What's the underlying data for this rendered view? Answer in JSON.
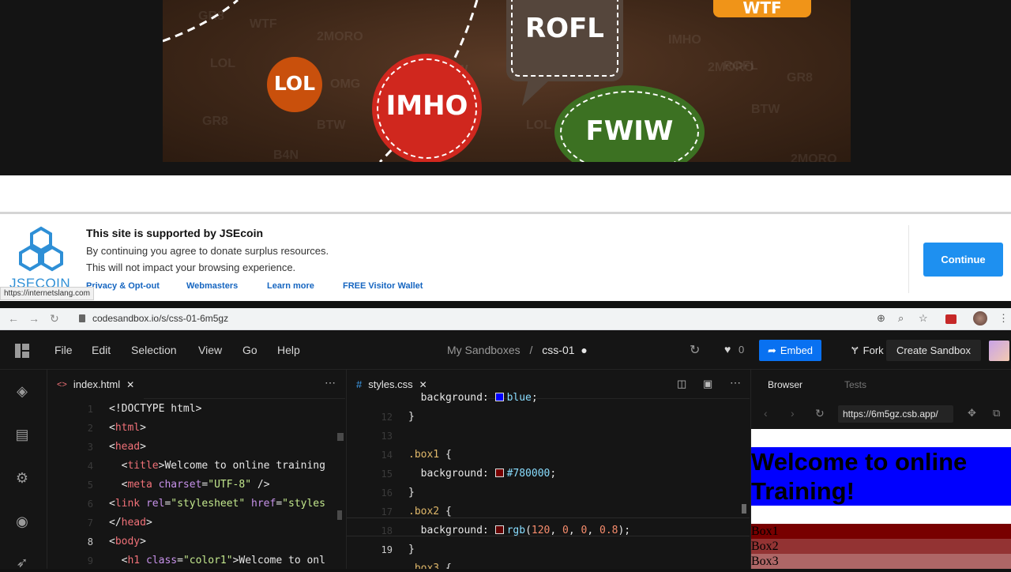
{
  "hero": {
    "bubbles": [
      "ROFL",
      "WTF",
      "LOL",
      "IMHO",
      "FWIW"
    ],
    "background_words": [
      "GR8",
      "WTF",
      "2MORO",
      "LOL",
      "OMG",
      "BTW",
      "B4N",
      "GR8",
      "BTW",
      "LOL",
      "IMHO",
      "2MORO",
      "BTW",
      "ROFL",
      "GR8",
      "2MORO"
    ],
    "colors": {
      "lol": "#c9500c",
      "imho": "#d0271e",
      "rofl": "#55463c",
      "fwiw": "#3c7122",
      "wtf": "#f09418"
    }
  },
  "ad": {
    "brand": "JSECOIN",
    "title": "This site is supported by JSEcoin",
    "line1": "By continuing you agree to donate surplus resources.",
    "line2": "This will not impact your browsing experience.",
    "links": [
      "Privacy & Opt-out",
      "Webmasters",
      "Learn more",
      "FREE Visitor Wallet"
    ],
    "continue_label": "Continue",
    "status_url": "https://internetslang.com"
  },
  "chrome": {
    "url": "codesandbox.io/s/css-01-6m5gz"
  },
  "csb": {
    "menu": [
      "File",
      "Edit",
      "Selection",
      "View",
      "Go",
      "Help"
    ],
    "breadcrumb_parent": "My Sandboxes",
    "breadcrumb_sep": "/",
    "breadcrumb_current": "css-01",
    "likes": "0",
    "embed_label": "Embed",
    "fork_label": "Fork",
    "create_label": "Create Sandbox",
    "accent": "#0971f1"
  },
  "editor1": {
    "tab": "index.html",
    "current_line": "8",
    "lines": [
      {
        "n": "1",
        "parts": [
          [
            "pr",
            "<!DOCTYPE html>"
          ]
        ]
      },
      {
        "n": "2",
        "parts": [
          [
            "pr",
            "<"
          ],
          [
            "tg",
            "html"
          ],
          [
            "pr",
            ">"
          ]
        ]
      },
      {
        "n": "3",
        "parts": [
          [
            "pr",
            "<"
          ],
          [
            "tg",
            "head"
          ],
          [
            "pr",
            ">"
          ]
        ]
      },
      {
        "n": "4",
        "parts": [
          [
            "pr",
            "  <"
          ],
          [
            "tg",
            "title"
          ],
          [
            "pr",
            ">Welcome to online training"
          ]
        ]
      },
      {
        "n": "5",
        "parts": [
          [
            "pr",
            "  <"
          ],
          [
            "tg",
            "meta"
          ],
          [
            "pr",
            " "
          ],
          [
            "at",
            "charset"
          ],
          [
            "pr",
            "="
          ],
          [
            "st",
            "\"UTF-8\""
          ],
          [
            "pr",
            " />"
          ]
        ]
      },
      {
        "n": "6",
        "parts": [
          [
            "pr",
            "<"
          ],
          [
            "tg",
            "link"
          ],
          [
            "pr",
            " "
          ],
          [
            "at",
            "rel"
          ],
          [
            "pr",
            "="
          ],
          [
            "st",
            "\"stylesheet\""
          ],
          [
            "pr",
            " "
          ],
          [
            "at",
            "href"
          ],
          [
            "pr",
            "="
          ],
          [
            "st",
            "\"styles"
          ]
        ]
      },
      {
        "n": "7",
        "parts": [
          [
            "pr",
            "</"
          ],
          [
            "tg",
            "head"
          ],
          [
            "pr",
            ">"
          ]
        ]
      },
      {
        "n": "8",
        "parts": [
          [
            "pr",
            "<"
          ],
          [
            "tg",
            "body"
          ],
          [
            "pr",
            ">"
          ]
        ]
      },
      {
        "n": "9",
        "parts": [
          [
            "pr",
            "  <"
          ],
          [
            "tg",
            "h1"
          ],
          [
            "pr",
            " "
          ],
          [
            "at",
            "class"
          ],
          [
            "pr",
            "="
          ],
          [
            "st",
            "\"color1\""
          ],
          [
            "pr",
            ">Welcome to onl"
          ]
        ]
      }
    ]
  },
  "editor2": {
    "tab": "styles.css",
    "current_line": "19",
    "lines": [
      {
        "n": "",
        "parts": [
          [
            "pr",
            "  background: "
          ],
          [
            "sw",
            "#0000ff"
          ],
          [
            "va",
            "blue"
          ],
          [
            "pr",
            ";"
          ]
        ]
      },
      {
        "n": "12",
        "parts": [
          [
            "pr",
            "}"
          ]
        ]
      },
      {
        "n": "13",
        "parts": []
      },
      {
        "n": "14",
        "parts": [
          [
            "sel",
            ".box1"
          ],
          [
            "pr",
            " {"
          ]
        ]
      },
      {
        "n": "15",
        "parts": [
          [
            "pr",
            "  background: "
          ],
          [
            "sw",
            "#780000"
          ],
          [
            "va",
            "#780000"
          ],
          [
            "pr",
            ";"
          ]
        ]
      },
      {
        "n": "16",
        "parts": [
          [
            "pr",
            "}"
          ]
        ]
      },
      {
        "n": "17",
        "parts": [
          [
            "sel",
            ".box2"
          ],
          [
            "pr",
            " {"
          ]
        ]
      },
      {
        "n": "18",
        "parts": [
          [
            "pr",
            "  background: "
          ],
          [
            "sw",
            "rgba(120,0,0,0.8)"
          ],
          [
            "va",
            "rgb"
          ],
          [
            "pr",
            "("
          ],
          [
            "nm",
            "120"
          ],
          [
            "pr",
            ", "
          ],
          [
            "nm",
            "0"
          ],
          [
            "pr",
            ", "
          ],
          [
            "nm",
            "0"
          ],
          [
            "pr",
            ", "
          ],
          [
            "nm",
            "0.8"
          ],
          [
            "pr",
            ");"
          ]
        ]
      },
      {
        "n": "19",
        "parts": [
          [
            "pr",
            "}"
          ]
        ]
      },
      {
        "n": "",
        "parts": [
          [
            "sel",
            ".box3"
          ],
          [
            "pr",
            " {"
          ]
        ]
      }
    ]
  },
  "preview": {
    "tab_browser": "Browser",
    "tab_tests": "Tests",
    "url": "https://6m5gz.csb.app/",
    "heading": "Welcome to online Training!",
    "heading_bg": "#0000ff",
    "boxes": [
      {
        "label": "Box1",
        "bg": "#780000"
      },
      {
        "label": "Box2",
        "bg": "#933333"
      },
      {
        "label": "Box3",
        "bg": "#ae6666"
      }
    ]
  }
}
